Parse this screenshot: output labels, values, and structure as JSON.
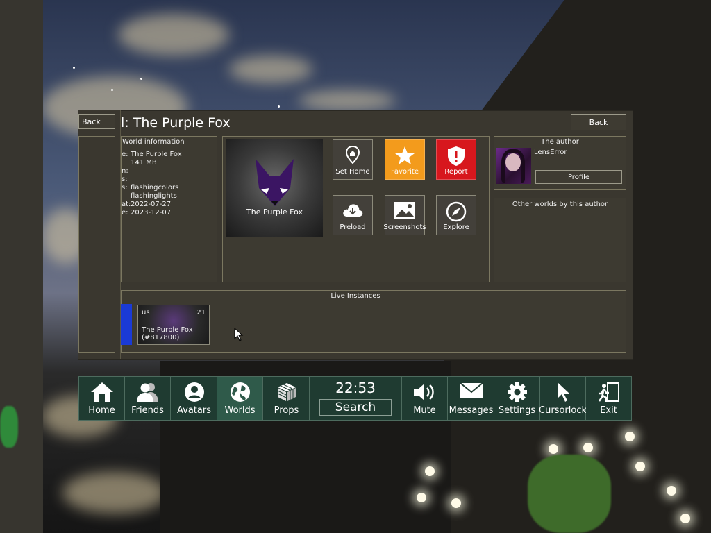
{
  "window": {
    "title": "l: The Purple Fox",
    "back_left": "Back",
    "back_right": "Back"
  },
  "world_info": {
    "heading": "World information",
    "rows": [
      {
        "key": "e:",
        "value": "The Purple Fox"
      },
      {
        "key": "",
        "value": "141 MB"
      },
      {
        "key": "n:",
        "value": ""
      },
      {
        "key": "s:",
        "value": ""
      },
      {
        "key": "s:",
        "value": "flashingcolors"
      },
      {
        "key": "",
        "value": "flashinglights"
      },
      {
        "key": "at:",
        "value": "2022-07-27"
      },
      {
        "key": "e:",
        "value": "2023-12-07"
      }
    ]
  },
  "thumbnail": {
    "caption": "The Purple Fox"
  },
  "actions": {
    "set_home": "Set Home",
    "favorite": "Favorite",
    "report": "Report",
    "preload": "Preload",
    "screenshots": "Screenshots",
    "explore": "Explore"
  },
  "author": {
    "heading": "The author",
    "name": "LensError",
    "profile_button": "Profile"
  },
  "other_worlds": {
    "heading": "Other worlds by this author"
  },
  "live_instances": {
    "heading": "Live Instances",
    "instance": {
      "region": "us",
      "count": "21",
      "name": "The Purple Fox",
      "id": "(#817800)"
    }
  },
  "menu": {
    "home": "Home",
    "friends": "Friends",
    "avatars": "Avatars",
    "worlds": "Worlds",
    "props": "Props",
    "time": "22:53",
    "search": "Search",
    "mute": "Mute",
    "messages": "Messages",
    "settings": "Settings",
    "cursorlock": "Cursorlock",
    "exit": "Exit"
  },
  "colors": {
    "favorite_bg": "#f39b1c",
    "report_bg": "#d7171d",
    "menu_bg": "#1f3b31",
    "menu_active": "#2f5a4a",
    "panel_bg": "#3a372f"
  },
  "icons": [
    "home-icon",
    "friends-icon",
    "avatar-icon",
    "globe-icon",
    "cube-icon",
    "speaker-icon",
    "envelope-icon",
    "gear-icon",
    "cursor-icon",
    "exit-door-icon",
    "location-pin-icon",
    "star-icon",
    "shield-alert-icon",
    "cloud-download-icon",
    "image-icon",
    "compass-icon"
  ]
}
